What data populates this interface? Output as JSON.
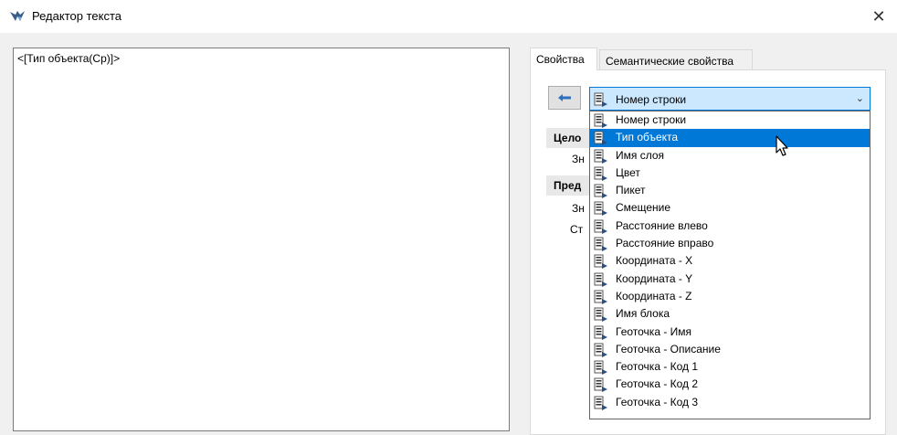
{
  "window": {
    "title": "Редактор текста",
    "close_glyph": "✕"
  },
  "editor": {
    "content": "<[Тип объекта(Ср)]>"
  },
  "tabs": [
    {
      "label": "Свойства",
      "active": true
    },
    {
      "label": "Семантические свойства",
      "active": false
    }
  ],
  "combo": {
    "selected": "Номер строки"
  },
  "groups": [
    {
      "title": "Цело"
    },
    {
      "title": "Пред"
    }
  ],
  "fields": [
    {
      "label": "Зн"
    },
    {
      "label": "Зн"
    },
    {
      "label": "Ст"
    }
  ],
  "dropdown": {
    "items": [
      "Номер строки",
      "Тип объекта",
      "Имя слоя",
      "Цвет",
      "Пикет",
      "Смещение",
      "Расстояние влево",
      "Расстояние вправо",
      "Координата - X",
      "Координата - Y",
      "Координата - Z",
      "Имя блока",
      "Геоточка - Имя",
      "Геоточка - Описание",
      "Геоточка - Код 1",
      "Геоточка - Код 2",
      "Геоточка - Код 3"
    ],
    "highlighted": "Тип объекта"
  },
  "colors": {
    "accent": "#0078d7",
    "combo_bg": "#cce8ff",
    "back_arrow": "#2f6fbf"
  },
  "icons": {
    "app": "app-logo-icon",
    "close": "close-icon",
    "back": "back-arrow-icon",
    "item": "field-list-item-icon",
    "chevron": "chevron-down-icon"
  }
}
